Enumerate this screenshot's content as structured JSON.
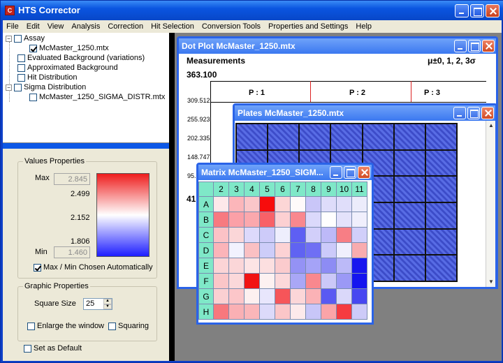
{
  "app": {
    "title": "HTS Corrector",
    "icon_letter": "C"
  },
  "window_buttons": [
    "minimize-icon",
    "maximize-icon",
    "close-icon"
  ],
  "menu": [
    "File",
    "Edit",
    "View",
    "Analysis",
    "Correction",
    "Hit Selection",
    "Conversion Tools",
    "Properties and Settings",
    "Help"
  ],
  "tree": {
    "items": [
      {
        "label": "Assay",
        "checked": false,
        "toggle": "−"
      },
      {
        "label": "McMaster_1250.mtx",
        "checked": true
      },
      {
        "label": "Evaluated Background (variations)",
        "checked": false
      },
      {
        "label": "Approximated Background",
        "checked": false
      },
      {
        "label": "Hit Distribution",
        "checked": false
      },
      {
        "label": "Sigma Distribution",
        "checked": false,
        "toggle": "−"
      },
      {
        "label": "McMaster_1250_SIGMA_DISTR.mtx",
        "checked": false
      }
    ]
  },
  "values_properties": {
    "title": "Values Properties",
    "max_label": "Max",
    "max_value": "2.845",
    "min_label": "Min",
    "min_value": "1.460",
    "scale_labels": [
      "2.499",
      "2.152",
      "1.806"
    ],
    "auto_label": "Max / Min Chosen Automatically",
    "auto_checked": true
  },
  "graphic_properties": {
    "title": "Graphic Properties",
    "square_size_label": "Square Size",
    "square_size_value": "25",
    "enlarge_label": "Enlarge the window",
    "squaring_label": "Squaring"
  },
  "set_default_label": "Set as Default",
  "dot_plot": {
    "title": "Dot Plot McMaster_1250.mtx",
    "heading": "Measurements",
    "sigma_label": "μ±0, 1, 2, 3σ",
    "top_value": "363.100",
    "y_ticks": [
      "309.512",
      "255.923",
      "202.335",
      "148.747",
      "95."
    ],
    "partial_bottom": "41",
    "plates": [
      "P : 1",
      "P : 2",
      "P : 3"
    ]
  },
  "plates_window": {
    "title": "Plates McMaster_1250.mtx"
  },
  "matrix": {
    "title": "Matrix McMaster_1250_SIGM...",
    "columns": [
      "2",
      "3",
      "4",
      "5",
      "6",
      "7",
      "8",
      "9",
      "10",
      "11"
    ],
    "rows": [
      "A",
      "B",
      "C",
      "D",
      "E",
      "F",
      "G",
      "H"
    ],
    "cells": [
      [
        "#fde8ea",
        "#fcb6ba",
        "#fbc6c9",
        "#f70c0c",
        "#fcd6d6",
        "#fefafa",
        "#c9c6f8",
        "#dedcfa",
        "#e0defa",
        "#ececfb"
      ],
      [
        "#f77a80",
        "#fba0a7",
        "#fba8ad",
        "#f86168",
        "#fcd0d2",
        "#f9888e",
        "#dbd9fb",
        "#fefefe",
        "#e4e2fb",
        "#f0effc"
      ],
      [
        "#fbc2c6",
        "#fbd6d8",
        "#ddd9fb",
        "#cdcbf9",
        "#eeeefd",
        "#5e5ff3",
        "#d2cffa",
        "#bdb9f8",
        "#f77e85",
        "#d1cffa"
      ],
      [
        "#fbb4b9",
        "#f2f2fe",
        "#fac0c3",
        "#cdcdf9",
        "#fcd2d4",
        "#6063f2",
        "#6f6ff4",
        "#cccafa",
        "#f0effd",
        "#f8acaf"
      ],
      [
        "#fbd4d6",
        "#fbd6d8",
        "#fde4e5",
        "#fcdfe0",
        "#fbcbcd",
        "#9492f5",
        "#a5a3f7",
        "#8d8cf4",
        "#bcbaf8",
        "#1717ef"
      ],
      [
        "#fbc6c8",
        "#fbd8da",
        "#f11313",
        "#fdf1f1",
        "#fcd8da",
        "#a9a7f6",
        "#f9888e",
        "#cbc8f8",
        "#9b99f6",
        "#1515ef"
      ],
      [
        "#fbd0d2",
        "#fcc6c9",
        "#fdf0f0",
        "#e8e6fc",
        "#f65559",
        "#fcd6d8",
        "#fbb2b6",
        "#5a59f2",
        "#dad8fa",
        "#4747f1"
      ],
      [
        "#f7787d",
        "#fab0b4",
        "#fbb6b9",
        "#dcdafa",
        "#fbc6c8",
        "#fdeaeb",
        "#c8c6f8",
        "#fba4a8",
        "#f53b40",
        "#cdcbf8"
      ]
    ]
  }
}
